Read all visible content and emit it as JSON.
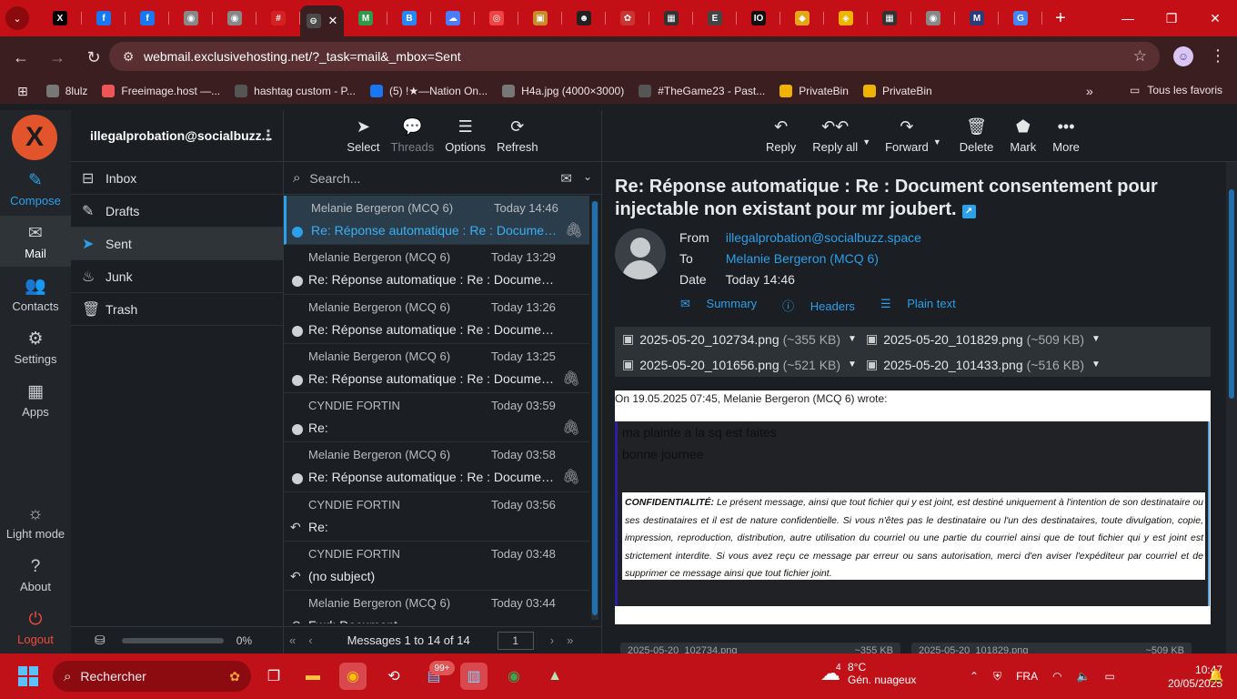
{
  "browser": {
    "tabs": [
      {
        "icon": "x-icon",
        "glyph": "X",
        "color": "#000000"
      },
      {
        "icon": "facebook-icon",
        "glyph": "f",
        "color": "#1877f2"
      },
      {
        "icon": "facebook-icon",
        "glyph": "f",
        "color": "#1877f2"
      },
      {
        "icon": "globe-icon",
        "glyph": "◉",
        "color": "#888888"
      },
      {
        "icon": "globe-icon",
        "glyph": "◉",
        "color": "#888888"
      },
      {
        "icon": "hashtag-icon",
        "glyph": "#",
        "color": "#d22222"
      },
      {
        "icon": "active-tab-icon",
        "glyph": "⊖",
        "color": "#4a4a4a",
        "active": true
      },
      {
        "icon": "map-icon",
        "glyph": "M",
        "color": "#2e9a4a"
      },
      {
        "icon": "vk-icon",
        "glyph": "B",
        "color": "#2787f5"
      },
      {
        "icon": "cloud-icon",
        "glyph": "☁",
        "color": "#4a7cff"
      },
      {
        "icon": "media-icon",
        "glyph": "◎",
        "color": "#e44"
      },
      {
        "icon": "image-icon",
        "glyph": "▣",
        "color": "#c88b2a"
      },
      {
        "icon": "robot-icon",
        "glyph": "☻",
        "color": "#222"
      },
      {
        "icon": "leaf-icon",
        "glyph": "✿",
        "color": "#c33"
      },
      {
        "icon": "pixel-icon",
        "glyph": "▦",
        "color": "#333"
      },
      {
        "icon": "docs-icon",
        "glyph": "E",
        "color": "#444"
      },
      {
        "icon": "io-icon",
        "glyph": "IO",
        "color": "#111"
      },
      {
        "icon": "folder-icon",
        "glyph": "◆",
        "color": "#e7a618"
      },
      {
        "icon": "privatebin-icon",
        "glyph": "◈",
        "color": "#f0b400"
      },
      {
        "icon": "pixel-icon",
        "glyph": "▦",
        "color": "#333"
      },
      {
        "icon": "globe-icon",
        "glyph": "◉",
        "color": "#888888"
      },
      {
        "icon": "m-icon",
        "glyph": "M",
        "color": "#2a3c7a"
      },
      {
        "icon": "google-icon",
        "glyph": "G",
        "color": "#4285f4"
      }
    ],
    "url": "webmail.exclusivehosting.net/?_task=mail&_mbox=Sent",
    "bookmarks": [
      {
        "label": "8lulz",
        "icon": "globe-icon",
        "color": "#777"
      },
      {
        "label": "Freeimage.host —...",
        "icon": "freeimage-icon",
        "color": "#e55"
      },
      {
        "label": "hashtag custom - P...",
        "icon": "pixel-icon",
        "color": "#555"
      },
      {
        "label": "(5) !★—Nation On...",
        "icon": "facebook-icon",
        "color": "#1877f2"
      },
      {
        "label": "H4a.jpg (4000×3000)",
        "icon": "globe-icon",
        "color": "#777"
      },
      {
        "label": "#TheGame23 - Past...",
        "icon": "pixel-icon",
        "color": "#555"
      },
      {
        "label": "PrivateBin",
        "icon": "privatebin-icon",
        "color": "#f0b400"
      },
      {
        "label": "PrivateBin",
        "icon": "privatebin-icon",
        "color": "#f0b400"
      }
    ],
    "all_bookmarks": "Tous les favoris"
  },
  "nav": {
    "compose": "Compose",
    "mail": "Mail",
    "contacts": "Contacts",
    "settings": "Settings",
    "apps": "Apps",
    "light_mode": "Light mode",
    "about": "About",
    "logout": "Logout"
  },
  "account": "illegalprobation@socialbuzz...",
  "folders": [
    {
      "name": "Inbox",
      "icon": "inbox-icon",
      "glyph": "⊟"
    },
    {
      "name": "Drafts",
      "icon": "pencil-icon",
      "glyph": "✎"
    },
    {
      "name": "Sent",
      "icon": "paper-plane-icon",
      "glyph": "➤",
      "selected": true
    },
    {
      "name": "Junk",
      "icon": "fire-icon",
      "glyph": "♨"
    },
    {
      "name": "Trash",
      "icon": "trash-icon",
      "glyph": "🗑"
    }
  ],
  "quota": "0%",
  "list_toolbar": {
    "select": "Select",
    "threads": "Threads",
    "options": "Options",
    "refresh": "Refresh"
  },
  "search": {
    "placeholder": "Search..."
  },
  "messages": [
    {
      "from": "Melanie Bergeron (MCQ 6)",
      "date": "Today 14:46",
      "subject": "Re: Réponse automatique : Re : Document consentement pour",
      "status": "dot",
      "attach": true,
      "selected": true
    },
    {
      "from": "Melanie Bergeron (MCQ 6)",
      "date": "Today 13:29",
      "subject": "Re: Réponse automatique : Re : Document consentement pour",
      "status": "dot",
      "attach": false
    },
    {
      "from": "Melanie Bergeron (MCQ 6)",
      "date": "Today 13:26",
      "subject": "Re: Réponse automatique : Re : Document consentement pour",
      "status": "dot",
      "attach": false
    },
    {
      "from": "Melanie Bergeron (MCQ 6)",
      "date": "Today 13:25",
      "subject": "Re: Réponse automatique : Re : Document consentement pour",
      "status": "dot",
      "attach": true
    },
    {
      "from": "CYNDIE FORTIN",
      "date": "Today 03:59",
      "subject": "Re:",
      "status": "dot",
      "attach": true
    },
    {
      "from": "Melanie Bergeron (MCQ 6)",
      "date": "Today 03:58",
      "subject": "Re: Réponse automatique : Re : Document consentement pour",
      "status": "dot",
      "attach": true
    },
    {
      "from": "CYNDIE FORTIN",
      "date": "Today 03:56",
      "subject": "Re:",
      "status": "reply",
      "attach": false
    },
    {
      "from": "CYNDIE FORTIN",
      "date": "Today 03:48",
      "subject": "(no subject)",
      "status": "reply",
      "attach": false
    },
    {
      "from": "Melanie Bergeron (MCQ 6)",
      "date": "Today 03:44",
      "subject": "Fwd: Document",
      "status": "reply",
      "attach": false
    }
  ],
  "pager": {
    "text": "Messages 1 to 14 of 14",
    "page": "1"
  },
  "reader_toolbar": {
    "reply": "Reply",
    "reply_all": "Reply all",
    "forward": "Forward",
    "delete": "Delete",
    "mark": "Mark",
    "more": "More"
  },
  "email": {
    "subject": "Re: Réponse automatique : Re : Document consentement pour injectable non existant pour mr joubert.",
    "from_label": "From",
    "from": "illegalprobation@socialbuzz.space",
    "to_label": "To",
    "to": "Melanie Bergeron (MCQ 6)",
    "date_label": "Date",
    "date": "Today 14:46",
    "links": {
      "summary": "Summary",
      "headers": "Headers",
      "plain": "Plain text"
    },
    "attachments": [
      {
        "name": "2025-05-20_102734.png",
        "size": "(~355 KB)"
      },
      {
        "name": "2025-05-20_101829.png",
        "size": "(~509 KB)"
      },
      {
        "name": "2025-05-20_101656.png",
        "size": "(~521 KB)"
      },
      {
        "name": "2025-05-20_101433.png",
        "size": "(~516 KB)"
      }
    ],
    "wrote": "On 19.05.2025 07:45, Melanie Bergeron (MCQ 6) wrote:",
    "quote_line1": "ma plainte a la sq est faites",
    "quote_line2": "bonne journee",
    "confidential_title": "CONFIDENTIALITÉ:",
    "confidential_text": "Le présent message, ainsi que tout fichier qui y est joint, est destiné uniquement à l'intention de son destinataire ou ses destinataires et il est de nature confidentielle. Si vous n'êtes pas le destinataire ou l'un des destinataires, toute divulgation, copie, impression, reproduction, distribution, autre utilisation du courriel ou une partie du courriel ainsi que de tout fichier qui y est joint est strictement interdite. Si vous avez reçu ce message par erreur ou sans autorisation, merci d'en aviser l'expéditeur par courriel et de supprimer ce message ainsi que tout fichier joint.",
    "tiles": [
      {
        "name": "2025-05-20_102734.png",
        "size": "~355 KB"
      },
      {
        "name": "2025-05-20_101829.png",
        "size": "~509 KB"
      }
    ]
  },
  "taskbar": {
    "search": "Rechercher",
    "badge": "99+",
    "weather_badge": "4",
    "temp": "8°C",
    "weather": "Gén. nuageux",
    "lang": "FRA",
    "time": "10:47",
    "date": "20/05/2025"
  },
  "colors": {
    "accent": "#2ba0eb",
    "logout": "#f04a3d",
    "chrome": "#c30f15",
    "logo": "#e2542b"
  }
}
